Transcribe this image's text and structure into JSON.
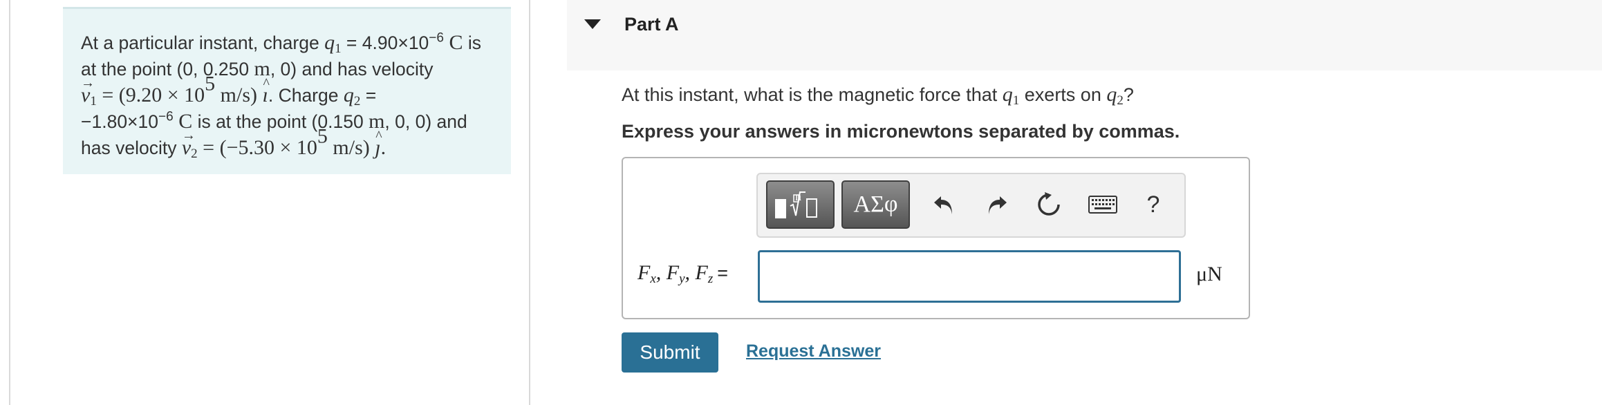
{
  "problem": {
    "intro": "At a particular instant, charge",
    "q1_symbol": "q",
    "q1_sub": "1",
    "q1_value": " = 4.90×10",
    "q1_exp": "−6",
    "q1_unit": " C",
    "q1_after": " is",
    "line2_pre": "at the point (0, 0.250 ",
    "line2_unit": "m",
    "line2_post": ", 0) and has velocity",
    "v1_symbol": "v",
    "v1_sub": "1",
    "v1_eq": " = (9.20 × 10",
    "v1_exp": "5",
    "v1_unit": " m/s) ",
    "v1_dir": "ı",
    "v1_after": ". Charge",
    "q2_symbol": "q",
    "q2_sub": "2",
    "q2_eq": " =",
    "q2_value": "−1.80×10",
    "q2_exp": "−6",
    "q2_unit": " C",
    "line4_pre": " is at the point (0.150 ",
    "line4_unit": "m",
    "line4_post": ", 0, 0) and",
    "line5_pre": "has velocity ",
    "v2_symbol": "v",
    "v2_sub": "2",
    "v2_eq": " = (−5.30 × 10",
    "v2_exp": "5",
    "v2_unit": " m/s) ",
    "v2_dir": "ȷ",
    "v2_after": "."
  },
  "part": {
    "title": "Part A"
  },
  "question": {
    "pre": "At this instant, what is the magnetic force that ",
    "q1_symbol": "q",
    "q1_sub": "1",
    "mid": " exerts on ",
    "q2_symbol": "q",
    "q2_sub": "2",
    "post": "?",
    "instruction": "Express your answers in micronewtons separated by commas."
  },
  "toolbar": {
    "symbols_label": "ΑΣφ",
    "help_label": "?",
    "icons": [
      "templates-icon",
      "undo-icon",
      "redo-icon",
      "reset-icon",
      "keyboard-icon",
      "help-icon"
    ]
  },
  "answer": {
    "var_f": "F",
    "sub_x": "x",
    "sub_y": "y",
    "sub_z": "z",
    "sep": ", ",
    "equals": "=",
    "value": "",
    "unit": "μN"
  },
  "actions": {
    "submit_label": "Submit",
    "request_label": "Request Answer"
  },
  "colors": {
    "problem_bg": "#e9f5f6",
    "accent": "#2a7095",
    "input_border": "#2e6f95"
  }
}
